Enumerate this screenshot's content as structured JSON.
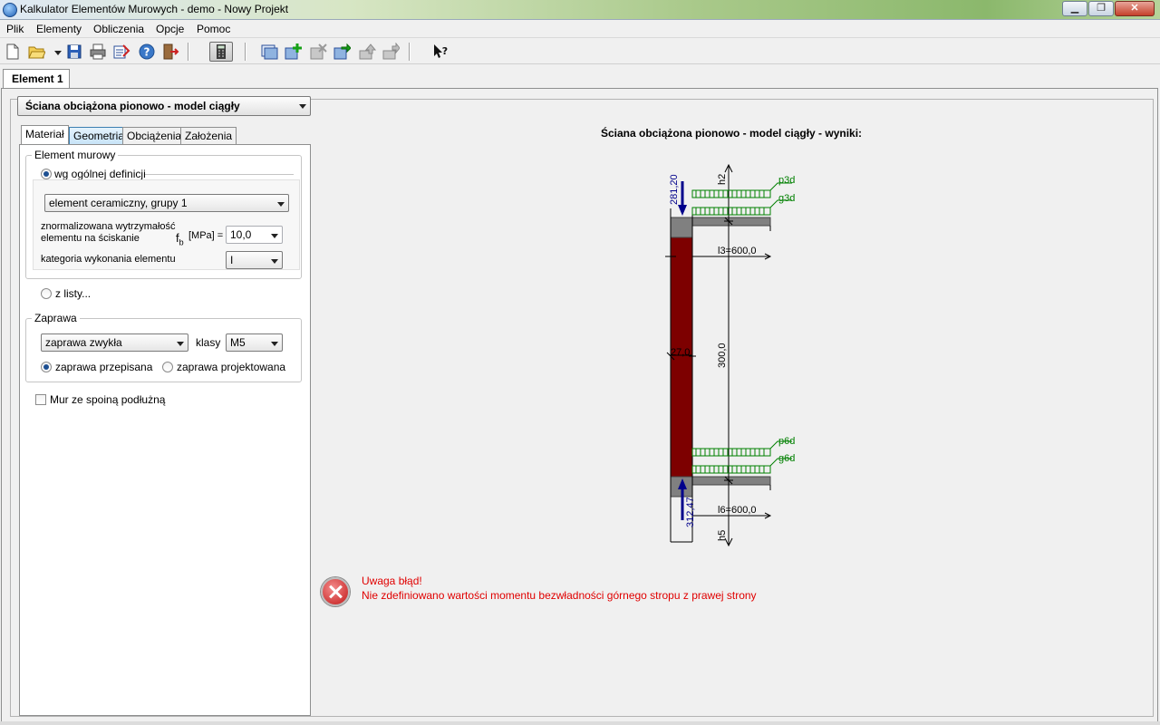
{
  "window": {
    "title": "Kalkulator Elementów Murowych - demo - Nowy Projekt",
    "minimize": "▁",
    "maximize": "❐",
    "close": "✕"
  },
  "menu": [
    "Plik",
    "Elementy",
    "Obliczenia",
    "Opcje",
    "Pomoc"
  ],
  "toolbar": {
    "icons": [
      "new-document-icon",
      "open-folder-icon",
      "save-icon",
      "print-icon",
      "export-icon",
      "help-icon",
      "exit-icon",
      "calculator-icon",
      "element-list-icon",
      "add-element-icon",
      "delete-element-icon",
      "copy-element-icon",
      "move-up-icon",
      "move-down-icon",
      "context-help-icon"
    ]
  },
  "element_tab": "Element 1",
  "type_combo": "Ściana obciążona pionowo - model ciągły",
  "subtabs": [
    "Materiał",
    "Geometria",
    "Obciążenia",
    "Założenia"
  ],
  "material": {
    "group_label": "Element murowy",
    "radio_general": "wg ogólnej definicji",
    "element_select": "element ceramiczny, grupy 1",
    "strength_label_1": "znormalizowana wytrzymałość",
    "strength_label_2": "elementu na ściskanie",
    "fb_symbol": "f",
    "fb_sub": "b",
    "fb_unit": "[MPa] =",
    "fb_value": "10,0",
    "category_label": "kategoria wykonania elementu",
    "category_value": "I",
    "radio_list": "z listy..."
  },
  "mortar": {
    "group_label": "Zaprawa",
    "type_select": "zaprawa zwykła",
    "class_label": "klasy",
    "class_value": "M5",
    "radio_prescribed": "zaprawa przepisana",
    "radio_designed": "zaprawa projektowana"
  },
  "checkbox_longitudinal": "Mur ze spoiną podłużną",
  "results": {
    "title": "Ściana obciążona pionowo - model ciągły - wyniki:",
    "diagram": {
      "top_force": "281,20",
      "bottom_force": "312,47",
      "thickness": "27,0",
      "height": "300,0",
      "h_top": "h2",
      "h_bottom": "h5",
      "p_top": "p3d",
      "g_top": "g3d",
      "p_bottom": "p6d",
      "g_bottom": "g6d",
      "span_top": "l3=600,0",
      "span_bottom": "l6=600,0"
    },
    "colors": {
      "wall": "#7d0000",
      "slab": "#808080",
      "load": "#008000",
      "force": "#00008b"
    }
  },
  "error": {
    "title": "Uwaga błąd!",
    "message": "Nie zdefiniowano wartości momentu bezwładności górnego stropu z prawej strony"
  }
}
